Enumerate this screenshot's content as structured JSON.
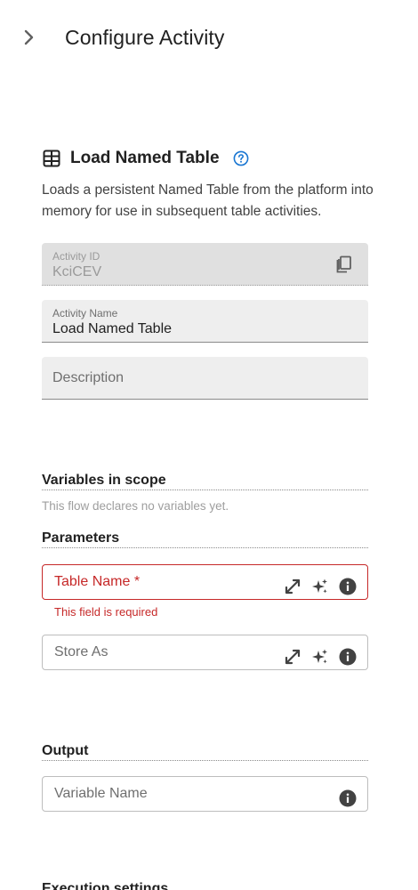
{
  "header": {
    "title": "Configure Activity",
    "collapse_icon": "chevron-right-icon"
  },
  "activity": {
    "title": "Load Named Table",
    "icon": "table-icon",
    "help_icon": "help-circle-icon",
    "description": "Loads a persistent Named Table from the platform into memory for use in subsequent table activities."
  },
  "fields": {
    "activity_id": {
      "label": "Activity ID",
      "value": "KciCEV",
      "copy_icon": "copy-icon"
    },
    "activity_name": {
      "label": "Activity Name",
      "value": "Load Named Table"
    },
    "description": {
      "placeholder": "Description"
    }
  },
  "variables": {
    "heading": "Variables in scope",
    "empty_text": "This flow declares no variables yet."
  },
  "parameters": {
    "heading": "Parameters",
    "table_name": {
      "label": "Table Name *",
      "error": "This field is required"
    },
    "store_as": {
      "label": "Store As"
    }
  },
  "output": {
    "heading": "Output",
    "variable_name": {
      "label": "Variable Name"
    }
  },
  "next_section": {
    "heading": "Execution settings"
  },
  "colors": {
    "error": "#c62828",
    "accent": "#1976d2",
    "field_bg": "#eeeeee"
  }
}
